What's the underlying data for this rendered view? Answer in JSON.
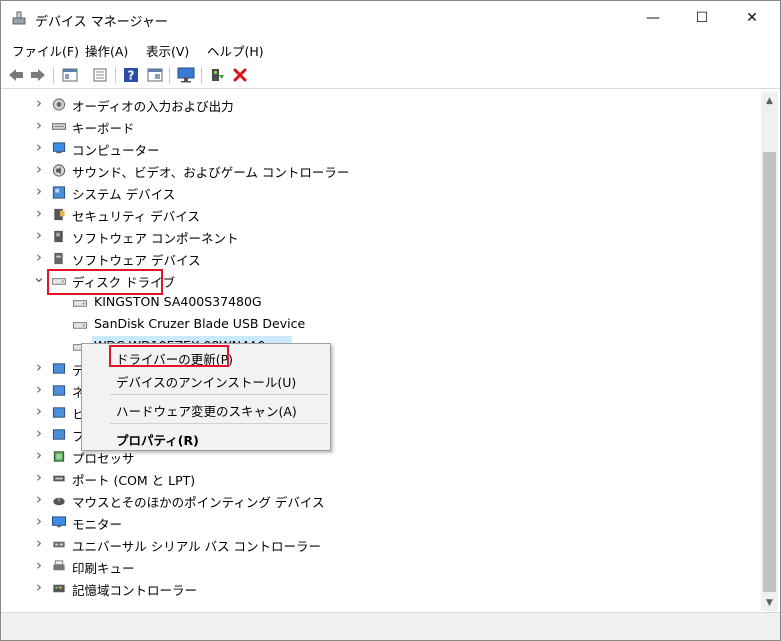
{
  "window": {
    "title": "デバイス マネージャー",
    "min_glyph": "—",
    "max_glyph": "☐",
    "close_glyph": "✕"
  },
  "menu": {
    "items": [
      "ファイル(F)",
      "操作(A)",
      "表示(V)",
      "ヘルプ(H)"
    ]
  },
  "toolbar": {
    "icons": [
      "back-arrow-icon",
      "forward-arrow-icon",
      "device-view-icon",
      "properties-icon",
      "help-icon",
      "scan-view-icon",
      "monitor-icon",
      "update-driver-icon",
      "uninstall-icon"
    ],
    "uninstall_color": "#d8141c",
    "help_color": "#2a4ea8"
  },
  "tree": {
    "categories": [
      {
        "label": "オーディオの入力および出力",
        "icon": "audio-icon",
        "expanded": false
      },
      {
        "label": "キーボード",
        "icon": "keyboard-icon",
        "expanded": false
      },
      {
        "label": "コンピューター",
        "icon": "computer-icon",
        "expanded": false
      },
      {
        "label": "サウンド、ビデオ、およびゲーム コントローラー",
        "icon": "sound-icon",
        "expanded": false
      },
      {
        "label": "システム デバイス",
        "icon": "system-device-icon",
        "expanded": false
      },
      {
        "label": "セキュリティ デバイス",
        "icon": "security-device-icon",
        "expanded": false
      },
      {
        "label": "ソフトウェア コンポーネント",
        "icon": "software-component-icon",
        "expanded": false
      },
      {
        "label": "ソフトウェア デバイス",
        "icon": "software-device-icon",
        "expanded": false
      },
      {
        "label": "ディスク ドライブ",
        "icon": "disk-drive-icon",
        "expanded": true
      }
    ],
    "disk_children": [
      {
        "label": "KINGSTON SA400S37480G"
      },
      {
        "label": "SanDisk Cruzer Blade USB Device"
      },
      {
        "label": "WDC WD10EZEX-08WN4A0"
      }
    ],
    "partial_labels": [
      "デ",
      "ネ",
      "ヒ",
      "フ"
    ],
    "lower_categories": [
      {
        "label": "プロセッサ",
        "icon": "processor-icon"
      },
      {
        "label": "ポート (COM と LPT)",
        "icon": "port-icon"
      },
      {
        "label": "マウスとそのほかのポインティング デバイス",
        "icon": "mouse-icon"
      },
      {
        "label": "モニター",
        "icon": "monitor-icon"
      },
      {
        "label": "ユニバーサル シリアル バス コントローラー",
        "icon": "usb-icon"
      },
      {
        "label": "印刷キュー",
        "icon": "print-queue-icon"
      },
      {
        "label": "記憶域コントローラー",
        "icon": "storage-controller-icon"
      }
    ]
  },
  "context_menu": {
    "items": [
      {
        "label": "ドライバーの更新(P)",
        "bold": false
      },
      {
        "label": "デバイスのアンインストール(U)",
        "bold": false
      },
      {
        "label": "ハードウェア変更のスキャン(A)",
        "bold": false
      },
      {
        "label": "プロパティ(R)",
        "bold": true
      }
    ]
  },
  "colors": {
    "highlight_box": "#e0152b",
    "selection": "#cce8ff"
  }
}
